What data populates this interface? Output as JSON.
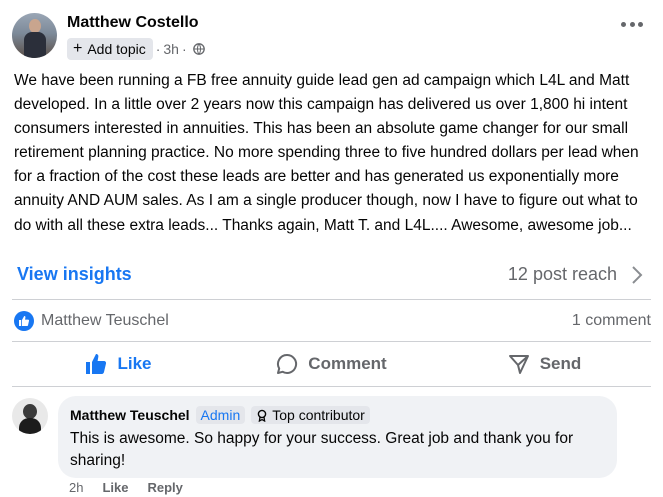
{
  "post": {
    "author": "Matthew Costello",
    "add_topic": "Add topic",
    "time": "3h",
    "text": "We have been running a FB free annuity guide lead gen ad campaign which L4L and Matt developed. In a little over 2 years now this campaign has delivered us over 1,800 hi intent consumers interested in annuities. This has been an absolute game changer for our small retirement planning practice. No more spending three to five hundred dollars per lead when for a fraction of the cost these leads are better and has generated us exponentially more annuity AND AUM sales. As I am a single producer though, now I have to figure out what to do with all these extra leads... Thanks again, Matt T. and L4L.... Awesome, awesome job...",
    "insights_label": "View insights",
    "reach": "12 post reach",
    "reaction_name": "Matthew Teuschel",
    "comments_count": "1 comment"
  },
  "actions": {
    "like": "Like",
    "comment": "Comment",
    "send": "Send"
  },
  "comment": {
    "author": "Matthew Teuschel",
    "admin_badge": "Admin",
    "top_badge": "Top contributor",
    "text": "This is awesome. So happy for your success. Great job and thank you for sharing!",
    "time": "2h",
    "like": "Like",
    "reply": "Reply"
  },
  "colors": {
    "accent": "#1877f2",
    "secondary_text": "#65676b",
    "bubble": "#f0f2f5"
  },
  "icons": [
    "plus-icon",
    "globe-icon",
    "more-icon",
    "chevron-right-icon",
    "like-reaction-icon",
    "like-icon",
    "comment-icon",
    "send-icon",
    "contributor-icon"
  ]
}
